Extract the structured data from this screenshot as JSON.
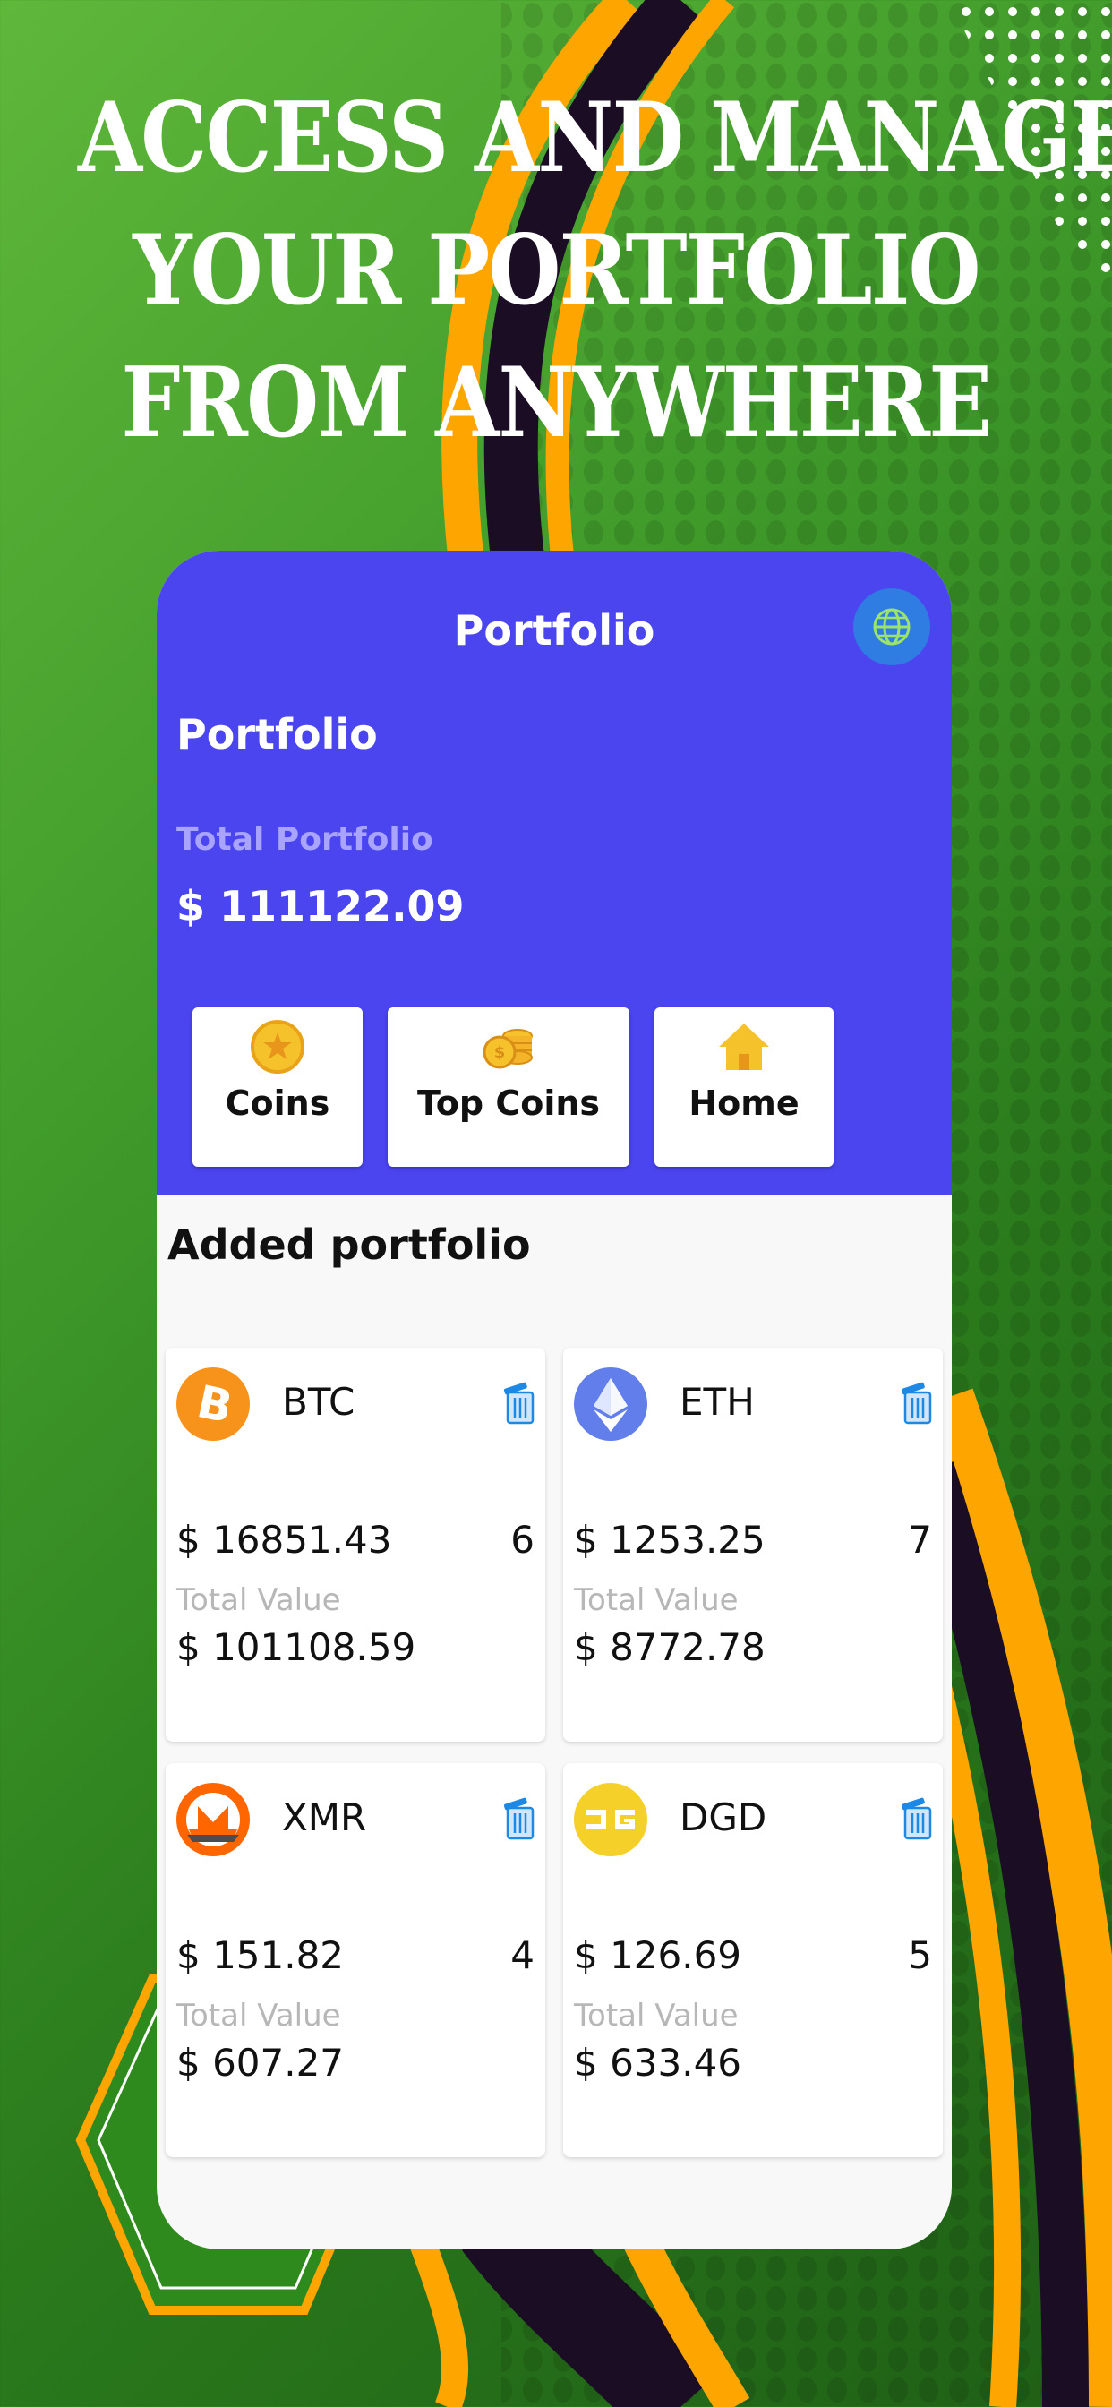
{
  "headline": {
    "line1": "ACCESS AND MANAGE",
    "line2": "YOUR PORTFOLIO",
    "line3": "FROM ANYWHERE"
  },
  "app": {
    "title": "Portfolio",
    "section_title": "Portfolio",
    "total_label": "Total Portfolio",
    "total_value": "$ 111122.09",
    "nav": {
      "coins": "Coins",
      "top_coins": "Top Coins",
      "home": "Home"
    },
    "added_title": "Added portfolio",
    "total_value_label": "Total Value",
    "cards": [
      {
        "symbol": "BTC",
        "price": "$ 16851.43",
        "qty": "6",
        "total": "$ 101108.59",
        "logo": "bitcoin-logo",
        "color": "#f7931a"
      },
      {
        "symbol": "ETH",
        "price": "$ 1253.25",
        "qty": "7",
        "total": "$ 8772.78",
        "logo": "ethereum-logo",
        "color": "#627eea"
      },
      {
        "symbol": "XMR",
        "price": "$ 151.82",
        "qty": "4",
        "total": "$ 607.27",
        "logo": "monero-logo",
        "color": "#ff6600"
      },
      {
        "symbol": "DGD",
        "price": "$ 126.69",
        "qty": "5",
        "total": "$ 633.46",
        "logo": "digixdao-logo",
        "color": "#f4d029"
      }
    ]
  },
  "colors": {
    "primary": "#4a45ee",
    "globe_button": "#2f7de3",
    "background_green": "#3f9a2a",
    "accent_orange": "#ffa500",
    "dark_stripe": "#1a0d24"
  }
}
